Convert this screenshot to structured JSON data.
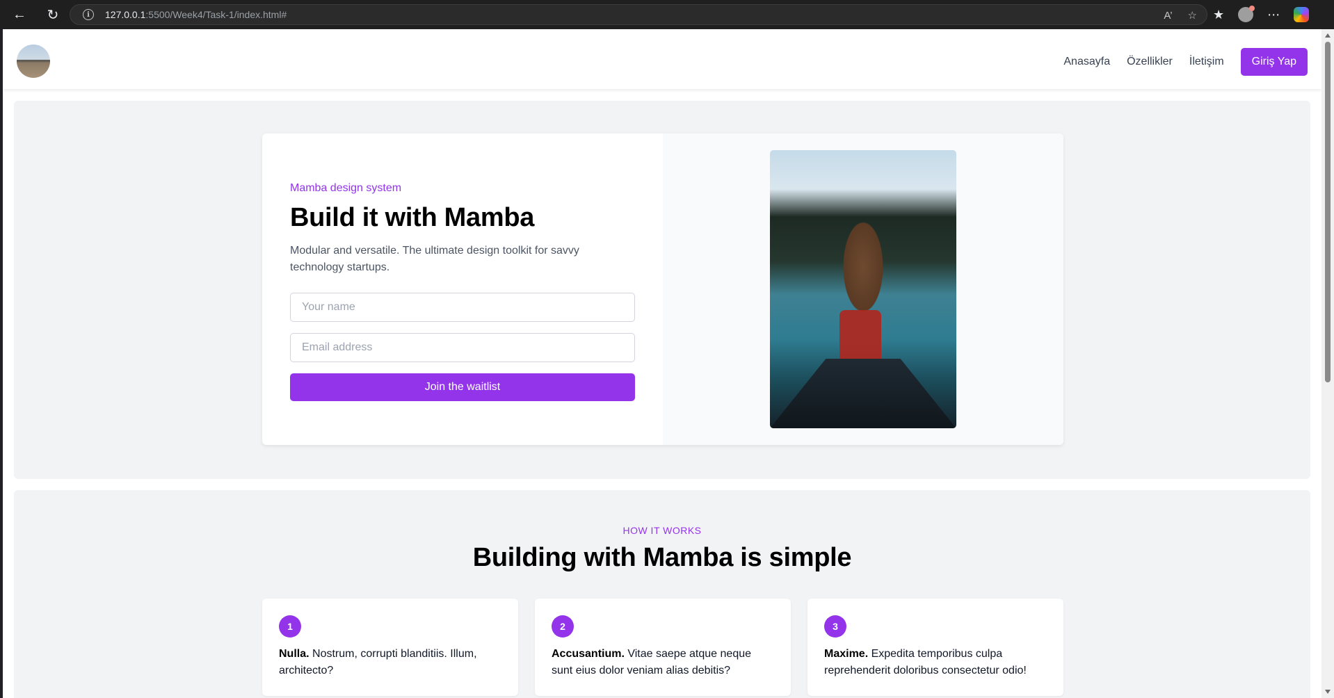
{
  "browser": {
    "url_host": "127.0.0.1",
    "url_rest": ":5500/Week4/Task-1/index.html#",
    "read_aloud_label": "A’"
  },
  "nav": {
    "links": [
      "Anasayfa",
      "Özellikler",
      "İletişim"
    ],
    "login_label": "Giriş Yap"
  },
  "hero": {
    "eyebrow": "Mamba design system",
    "title": "Build it with Mamba",
    "description": "Modular and versatile. The ultimate design toolkit for savvy technology startups.",
    "name_placeholder": "Your name",
    "email_placeholder": "Email address",
    "button_label": "Join the waitlist"
  },
  "how": {
    "eyebrow": "HOW IT WORKS",
    "title": "Building with Mamba is simple",
    "steps": [
      {
        "number": "1",
        "strong": "Nulla.",
        "text": " Nostrum, corrupti blanditiis. Illum, architecto?"
      },
      {
        "number": "2",
        "strong": "Accusantium.",
        "text": " Vitae saepe atque neque sunt eius dolor veniam alias debitis?"
      },
      {
        "number": "3",
        "strong": "Maxime.",
        "text": " Expedita temporibus culpa reprehenderit doloribus consectetur odio!"
      }
    ]
  },
  "colors": {
    "accent": "#9333ea",
    "section_bg": "#f2f3f5"
  }
}
